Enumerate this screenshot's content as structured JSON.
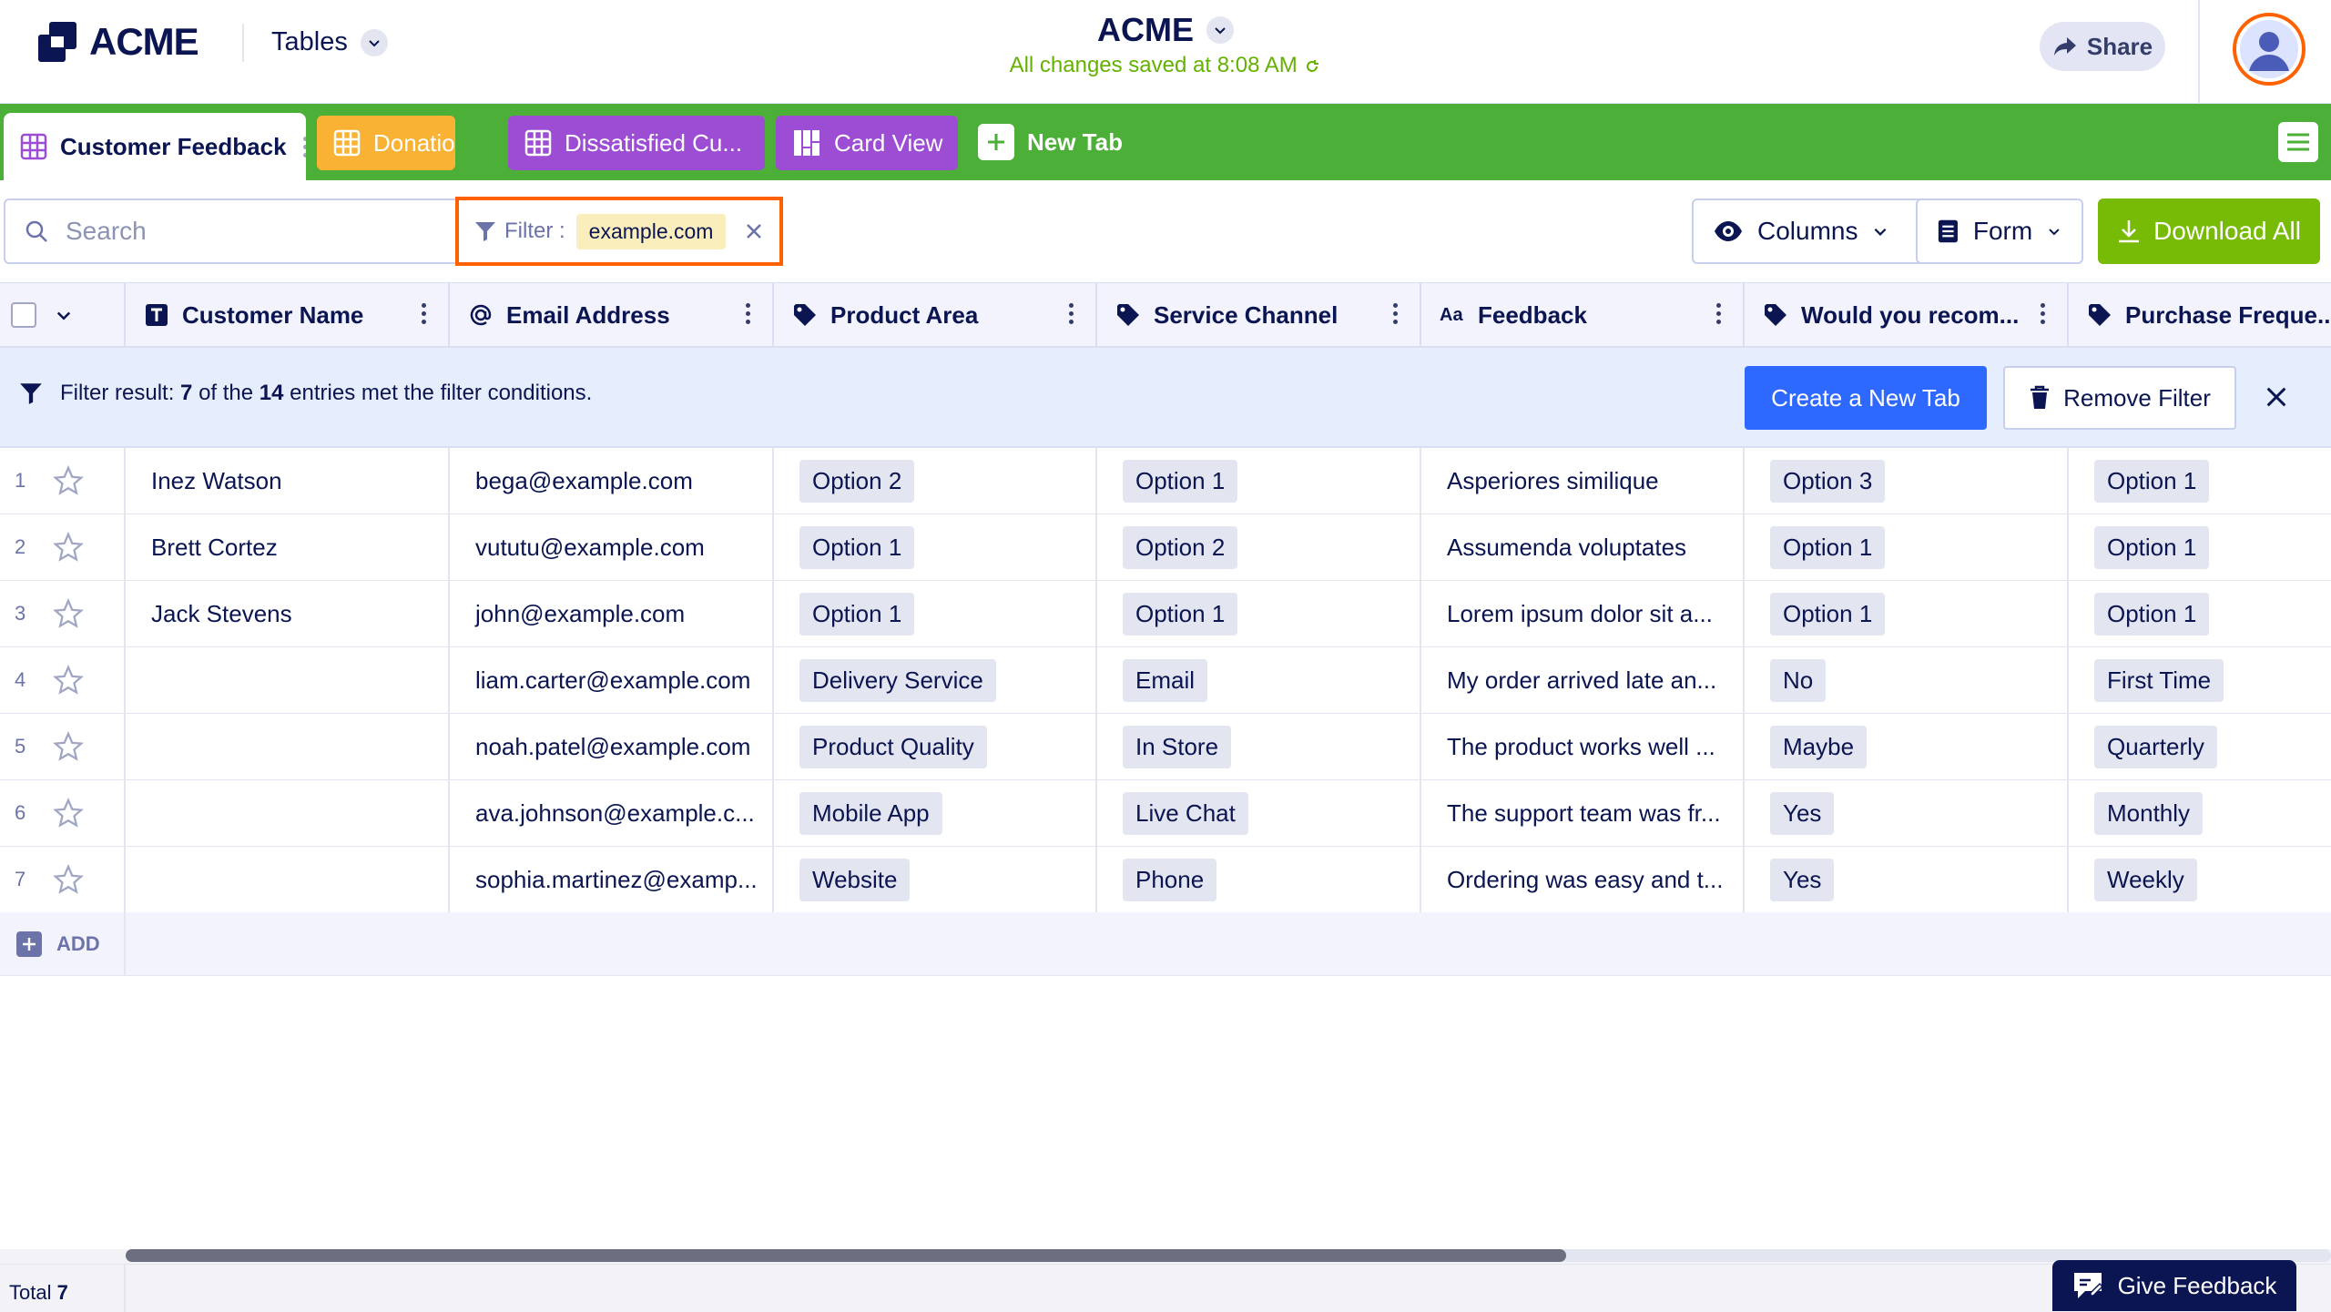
{
  "header": {
    "logo_text": "ACME",
    "nav_label": "Tables",
    "app_title": "ACME",
    "saved_status": "All changes saved at 8:08 AM",
    "share_label": "Share"
  },
  "tabs": [
    {
      "label": "Customer Feedback",
      "color": "#ffffff",
      "active": true
    },
    {
      "label": "Donations",
      "color": "#f9b233"
    },
    {
      "label": "Dissatisfied Cu...",
      "color": "#9c4dd3"
    },
    {
      "label": "Card View",
      "color": "#9c4dd3"
    },
    {
      "label": "New Tab"
    }
  ],
  "toolbar": {
    "search_placeholder": "Search",
    "filter_label": "Filter :",
    "filter_value": "example.com",
    "columns_label": "Columns",
    "form_label": "Form",
    "download_label": "Download All"
  },
  "columns": [
    {
      "label": "Customer Name",
      "icon": "text-icon"
    },
    {
      "label": "Email Address",
      "icon": "at-icon"
    },
    {
      "label": "Product Area",
      "icon": "tag-icon"
    },
    {
      "label": "Service Channel",
      "icon": "tag-icon"
    },
    {
      "label": "Feedback",
      "icon": "long-text-icon"
    },
    {
      "label": "Would you recom...",
      "icon": "tag-icon"
    },
    {
      "label": "Purchase Freque...",
      "icon": "tag-icon"
    }
  ],
  "filter_banner": {
    "prefix": "Filter result:",
    "matched": "7",
    "of_the": "of the",
    "total": "14",
    "suffix": "entries met the filter conditions.",
    "create_tab_label": "Create a New Tab",
    "remove_filter_label": "Remove Filter"
  },
  "rows": [
    {
      "n": "1",
      "name": "Inez Watson",
      "email": "bega@example.com",
      "area": "Option 2",
      "channel": "Option 1",
      "feedback": "Asperiores similique",
      "recommend": "Option 3",
      "frequency": "Option 1"
    },
    {
      "n": "2",
      "name": "Brett Cortez",
      "email": "vututu@example.com",
      "area": "Option 1",
      "channel": "Option 2",
      "feedback": "Assumenda voluptates",
      "recommend": "Option 1",
      "frequency": "Option 1"
    },
    {
      "n": "3",
      "name": "Jack Stevens",
      "email": "john@example.com",
      "area": "Option 1",
      "channel": "Option 1",
      "feedback": "Lorem ipsum dolor sit a...",
      "recommend": "Option 1",
      "frequency": "Option 1"
    },
    {
      "n": "4",
      "name": "",
      "email": "liam.carter@example.com",
      "area": "Delivery Service",
      "channel": "Email",
      "feedback": "My order arrived late an...",
      "recommend": "No",
      "frequency": "First Time"
    },
    {
      "n": "5",
      "name": "",
      "email": "noah.patel@example.com",
      "area": "Product Quality",
      "channel": "In Store",
      "feedback": "The product works well ...",
      "recommend": "Maybe",
      "frequency": "Quarterly"
    },
    {
      "n": "6",
      "name": "",
      "email": "ava.johnson@example.c...",
      "area": "Mobile App",
      "channel": "Live Chat",
      "feedback": "The support team was fr...",
      "recommend": "Yes",
      "frequency": "Monthly"
    },
    {
      "n": "7",
      "name": "",
      "email": "sophia.martinez@examp...",
      "area": "Website",
      "channel": "Phone",
      "feedback": "Ordering was easy and t...",
      "recommend": "Yes",
      "frequency": "Weekly"
    }
  ],
  "add_label": "ADD",
  "footer": {
    "total_label": "Total",
    "total_value": "7",
    "give_feedback_label": "Give Feedback"
  },
  "colors": {
    "tabbar": "#4caf38",
    "primary_button": "#2e69ff",
    "download_button": "#78bb07",
    "filter_highlight": "#ff6100",
    "navy": "#0a1551"
  }
}
